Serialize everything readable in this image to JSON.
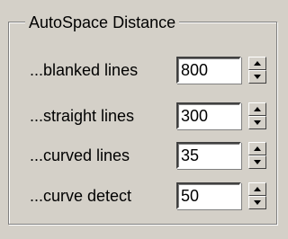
{
  "group": {
    "title": "AutoSpace Distance"
  },
  "rows": [
    {
      "label": "...blanked lines",
      "value": "800"
    },
    {
      "label": "...straight lines",
      "value": "300"
    },
    {
      "label": "...curved lines",
      "value": "35"
    },
    {
      "label": "...curve detect",
      "value": "50"
    }
  ],
  "icons": {
    "spin_up": "spin-up-arrow-icon",
    "spin_down": "spin-down-arrow-icon"
  },
  "colors": {
    "background": "#d4d0c8",
    "field": "#ffffff"
  }
}
